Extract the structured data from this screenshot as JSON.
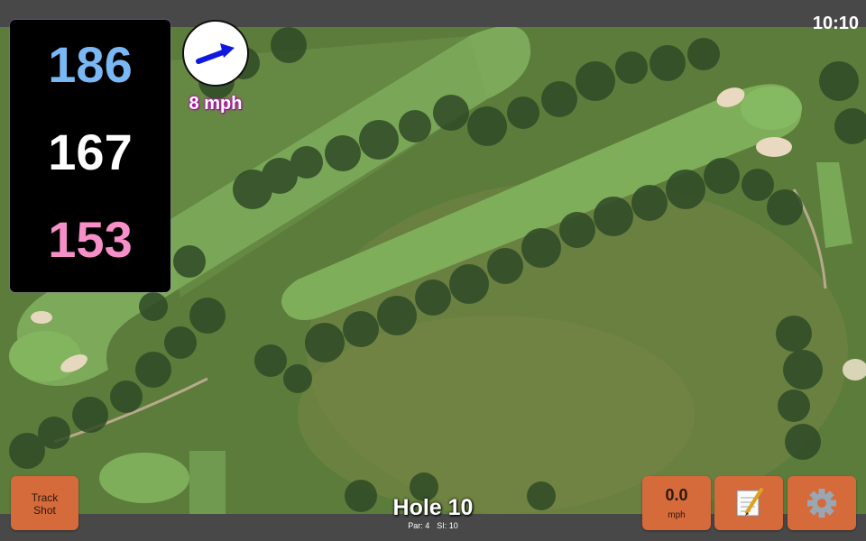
{
  "status_bar": {
    "time": "10:10"
  },
  "distances": {
    "back": "186",
    "middle": "167",
    "front": "153"
  },
  "wind": {
    "speed": "8 mph",
    "direction_icon": "arrow-up-right-icon"
  },
  "hole": {
    "title": "Hole 10",
    "par": "Par: 4",
    "stroke_index": "SI: 10"
  },
  "buttons": {
    "track_shot_line1": "Track",
    "track_shot_line2": "Shot",
    "speed_value": "0.0",
    "speed_unit": "mph",
    "notes_icon": "notepad-pencil-icon",
    "settings_icon": "gear-icon"
  },
  "colors": {
    "back_distance": "#7ab8f5",
    "middle_distance": "#ffffff",
    "front_distance": "#f78fc8",
    "button_bg": "#d56a3b",
    "wind_arrow": "#1018e0"
  }
}
